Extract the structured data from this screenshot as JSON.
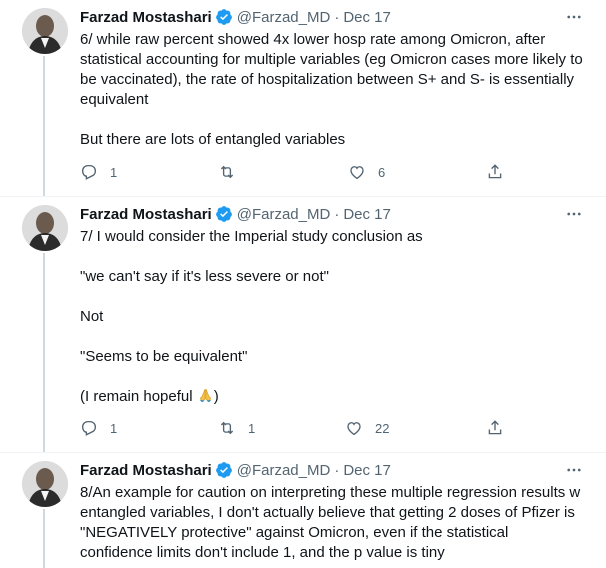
{
  "colors": {
    "accent": "#1d9bf0",
    "muted": "#536471",
    "text": "#0f1419",
    "line": "#cfd9de"
  },
  "tweets": [
    {
      "author": "Farzad Mostashari",
      "handle": "@Farzad_MD",
      "separator": "·",
      "date": "Dec 17",
      "verified_icon": "verified-badge-icon",
      "lines": [
        "6/ while raw percent showed 4x lower hosp rate among Omicron, after",
        "statistical accounting for multiple variables (eg Omicron cases more likely to",
        "be vaccinated), the rate of hospitalization between S+ and S- is essentially",
        "equivalent",
        "",
        "But there are lots of entangled variables"
      ],
      "replies": "1",
      "retweets": "",
      "likes": "6"
    },
    {
      "author": "Farzad Mostashari",
      "handle": "@Farzad_MD",
      "separator": "·",
      "date": "Dec 17",
      "verified_icon": "verified-badge-icon",
      "lines": [
        "7/ I would consider the Imperial study conclusion as",
        "",
        "\"we can't say if it's less severe or not\"",
        "",
        "Not",
        "",
        "\"Seems to be equivalent\"",
        "",
        "(I remain hopeful "
      ],
      "closing": ")",
      "emoji": "folded-hands-emoji",
      "replies": "1",
      "retweets": "1",
      "likes": "22"
    },
    {
      "author": "Farzad Mostashari",
      "handle": "@Farzad_MD",
      "separator": "·",
      "date": "Dec 17",
      "verified_icon": "verified-badge-icon",
      "lines": [
        "8/An example for caution on interpreting these multiple regression results w",
        "entangled variables, I don't actually believe that getting 2 doses of Pfizer is",
        "\"NEGATIVELY protective\" against Omicron, even if the statistical",
        "confidence limits don't include 1, and the p value is tiny"
      ]
    }
  ]
}
